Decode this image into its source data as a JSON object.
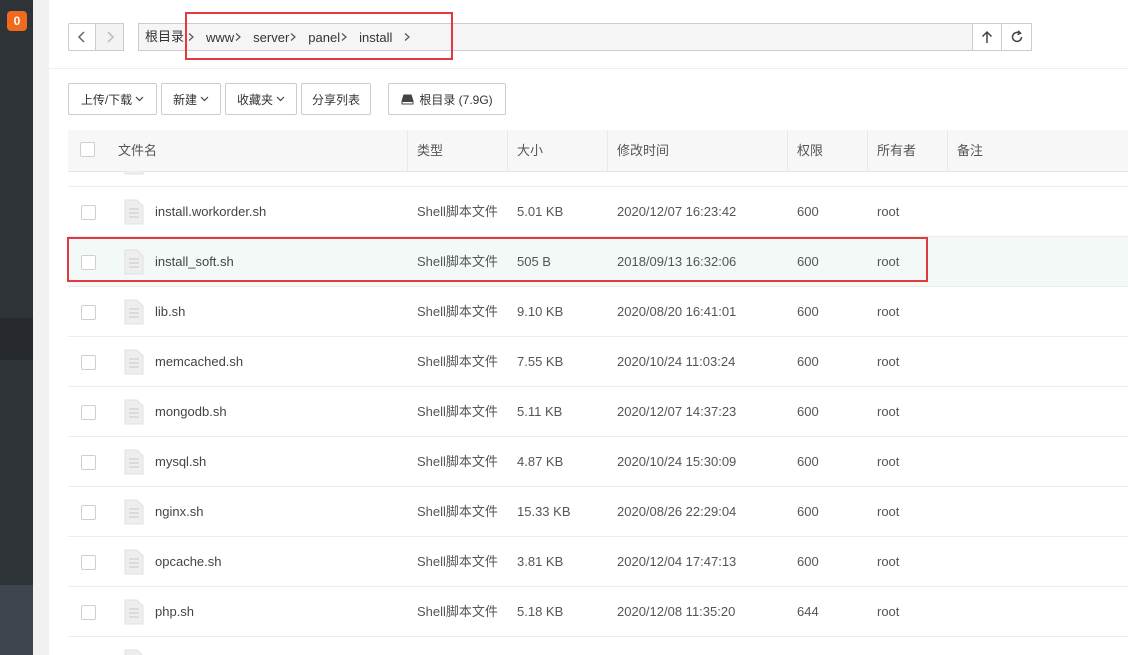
{
  "sidebar": {
    "badge": "0"
  },
  "nav": {
    "root_label": "根目录",
    "path": [
      "www",
      "server",
      "panel",
      "install"
    ]
  },
  "toolbar": {
    "upload_download": "上传/下载",
    "new": "新建",
    "favorites": "收藏夹",
    "share_list": "分享列表",
    "disk_label": "根目录 (7.9G)"
  },
  "table": {
    "headers": {
      "name": "文件名",
      "type": "类型",
      "size": "大小",
      "modified": "修改时间",
      "perm": "权限",
      "owner": "所有者",
      "note": "备注"
    },
    "rows": [
      {
        "name": "install.workorder.sh",
        "type": "Shell脚本文件",
        "size": "5.01 KB",
        "modified": "2020/12/07 16:23:42",
        "perm": "600",
        "owner": "root"
      },
      {
        "name": "install_soft.sh",
        "type": "Shell脚本文件",
        "size": "505 B",
        "modified": "2018/09/13 16:32:06",
        "perm": "600",
        "owner": "root"
      },
      {
        "name": "lib.sh",
        "type": "Shell脚本文件",
        "size": "9.10 KB",
        "modified": "2020/08/20 16:41:01",
        "perm": "600",
        "owner": "root"
      },
      {
        "name": "memcached.sh",
        "type": "Shell脚本文件",
        "size": "7.55 KB",
        "modified": "2020/10/24 11:03:24",
        "perm": "600",
        "owner": "root"
      },
      {
        "name": "mongodb.sh",
        "type": "Shell脚本文件",
        "size": "5.11 KB",
        "modified": "2020/12/07 14:37:23",
        "perm": "600",
        "owner": "root"
      },
      {
        "name": "mysql.sh",
        "type": "Shell脚本文件",
        "size": "4.87 KB",
        "modified": "2020/10/24 15:30:09",
        "perm": "600",
        "owner": "root"
      },
      {
        "name": "nginx.sh",
        "type": "Shell脚本文件",
        "size": "15.33 KB",
        "modified": "2020/08/26 22:29:04",
        "perm": "600",
        "owner": "root"
      },
      {
        "name": "opcache.sh",
        "type": "Shell脚本文件",
        "size": "3.81 KB",
        "modified": "2020/12/04 17:47:13",
        "perm": "600",
        "owner": "root"
      },
      {
        "name": "php.sh",
        "type": "Shell脚本文件",
        "size": "5.18 KB",
        "modified": "2020/12/08 11:35:20",
        "perm": "644",
        "owner": "root"
      }
    ]
  }
}
